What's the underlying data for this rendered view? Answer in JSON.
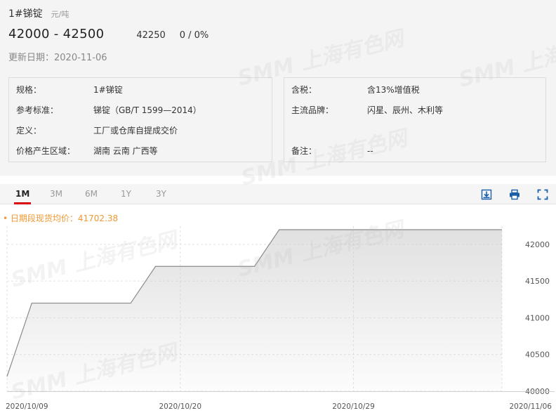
{
  "header": {
    "title": "1#锑锭",
    "unit": "元/吨",
    "price_range": "42000 - 42500",
    "average": "42250",
    "change": "0 / 0%",
    "update_date": "更新日期：2020-11-06"
  },
  "info_left": [
    {
      "label": "规格：",
      "value": "1#锑锭"
    },
    {
      "label": "参考标准：",
      "value": "锑锭（GB/T 1599—2014）"
    },
    {
      "label": "定义：",
      "value": "工厂或仓库自提成交价"
    },
    {
      "label": "价格产生区域：",
      "value": "湖南 云南 广西等"
    }
  ],
  "info_right": [
    {
      "label": "含税：",
      "value": "含13%增值税"
    },
    {
      "label": "主流品牌：",
      "value": "闪星、辰州、木利等"
    },
    {
      "label": "备注：",
      "value": "--"
    }
  ],
  "tabs": [
    "1M",
    "3M",
    "6M",
    "1Y",
    "3Y"
  ],
  "active_tab": "1M",
  "tools": [
    "download-icon",
    "print-icon",
    "fullscreen-icon"
  ],
  "watermark": "SMM 上海有色网",
  "colors": {
    "accent": "#d9000e",
    "line": "#8a8a8a",
    "avg_text": "#f29833"
  },
  "chart_data": {
    "type": "area",
    "avg_label": "• 日期段现货均价：41702.38",
    "x": [
      "2020/10/09",
      "2020/10/12",
      "2020/10/13",
      "2020/10/14",
      "2020/10/15",
      "2020/10/16",
      "2020/10/19",
      "2020/10/20",
      "2020/10/21",
      "2020/10/22",
      "2020/10/23",
      "2020/10/26",
      "2020/10/27",
      "2020/10/28",
      "2020/10/29",
      "2020/10/30",
      "2020/11/02",
      "2020/11/03",
      "2020/11/04",
      "2020/11/05",
      "2020/11/06"
    ],
    "values": [
      40200,
      41200,
      41200,
      41200,
      41200,
      41200,
      41700,
      41700,
      41700,
      41700,
      41700,
      42200,
      42200,
      42200,
      42200,
      42200,
      42200,
      42200,
      42200,
      42200,
      42200
    ],
    "x_tick_labels": [
      "2020/10/09",
      "2020/10/20",
      "2020/10/29",
      "2020/11/06"
    ],
    "ylim": [
      40000,
      42200
    ],
    "y_ticks": [
      40000,
      40500,
      41000,
      41500,
      42000
    ],
    "grid": true,
    "y_axis_side": "right"
  }
}
